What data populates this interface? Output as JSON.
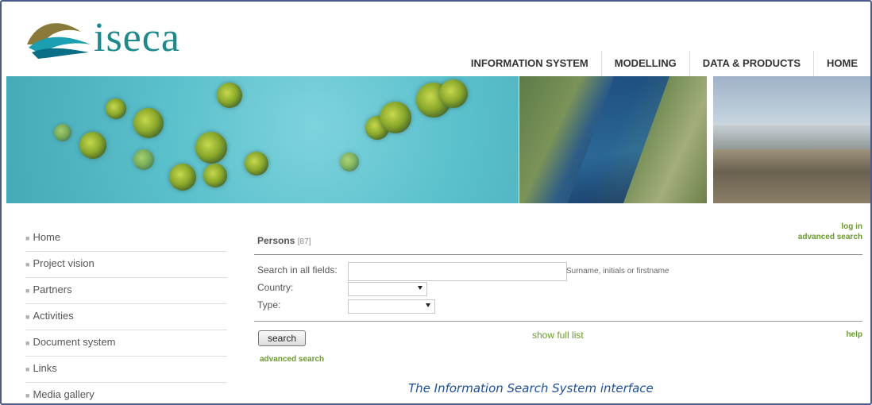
{
  "brand": {
    "logo_text": "iseca"
  },
  "topnav": [
    {
      "label": "INFORMATION SYSTEM"
    },
    {
      "label": "MODELLING"
    },
    {
      "label": "DATA & PRODUCTS"
    },
    {
      "label": "HOME"
    }
  ],
  "sidebar": {
    "items": [
      {
        "label": "Home"
      },
      {
        "label": "Project vision"
      },
      {
        "label": "Partners"
      },
      {
        "label": "Activities"
      },
      {
        "label": "Document system"
      },
      {
        "label": "Links"
      },
      {
        "label": "Media gallery"
      }
    ]
  },
  "main": {
    "login": "log in",
    "advanced_top": "advanced search",
    "title": "Persons",
    "count": "[87]",
    "search_all_label": "Search in all fields:",
    "search_all_value": "",
    "search_hint": "Surname, initials or firstname",
    "country_label": "Country:",
    "country_value": "",
    "type_label": "Type:",
    "type_value": "",
    "search_button": "search",
    "show_full_list": "show full list",
    "help": "help",
    "advanced_bottom": "advanced search"
  },
  "caption": "The Information Search System interface",
  "colors": {
    "accent_green": "#6a9a2a",
    "logo_teal": "#1a8a8c",
    "caption_blue": "#1d4fa0"
  },
  "icons": {
    "dropdown": "chevron-down-icon",
    "bullet": "square-bullet-icon"
  }
}
